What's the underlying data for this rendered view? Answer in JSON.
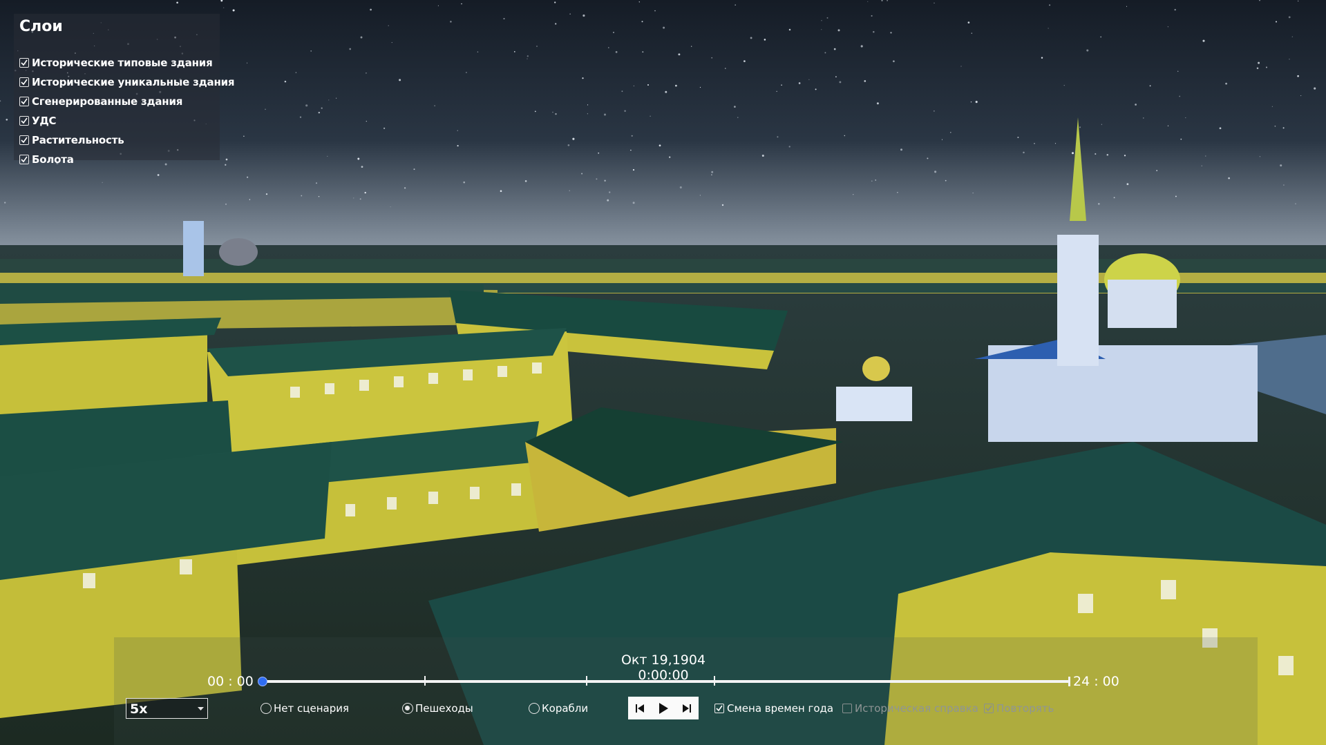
{
  "layers_panel": {
    "title": "Слои",
    "items": [
      {
        "label": "Исторические типовые здания",
        "checked": true
      },
      {
        "label": "Исторические уникальные здания",
        "checked": true
      },
      {
        "label": "Сгенерированные здания",
        "checked": true
      },
      {
        "label": "УДС",
        "checked": true
      },
      {
        "label": "Растительность",
        "checked": true
      },
      {
        "label": "Болота",
        "checked": true
      }
    ]
  },
  "timeline": {
    "date": "Окт 19,1904 0:00:00",
    "start_label": "00 : 00",
    "end_label": "24 : 00",
    "progress": 0
  },
  "speed": {
    "selected": "5x"
  },
  "scenarios": [
    {
      "label": "Нет сценария",
      "selected": false
    },
    {
      "label": "Пешеходы",
      "selected": true
    },
    {
      "label": "Корабли",
      "selected": false
    }
  ],
  "playback": {
    "prev": "skip-back-icon",
    "play": "play-icon",
    "next": "skip-forward-icon"
  },
  "options": [
    {
      "label": "Смена времен года",
      "checked": true,
      "enabled": true
    },
    {
      "label": "Историческая справка",
      "checked": false,
      "enabled": false
    },
    {
      "label": "Повторять",
      "checked": true,
      "enabled": false
    }
  ],
  "colors": {
    "accent": "#2f6df2",
    "building_walls": "#c9c23c",
    "roofs": "#1d5048",
    "sky_top": "#141c26"
  }
}
